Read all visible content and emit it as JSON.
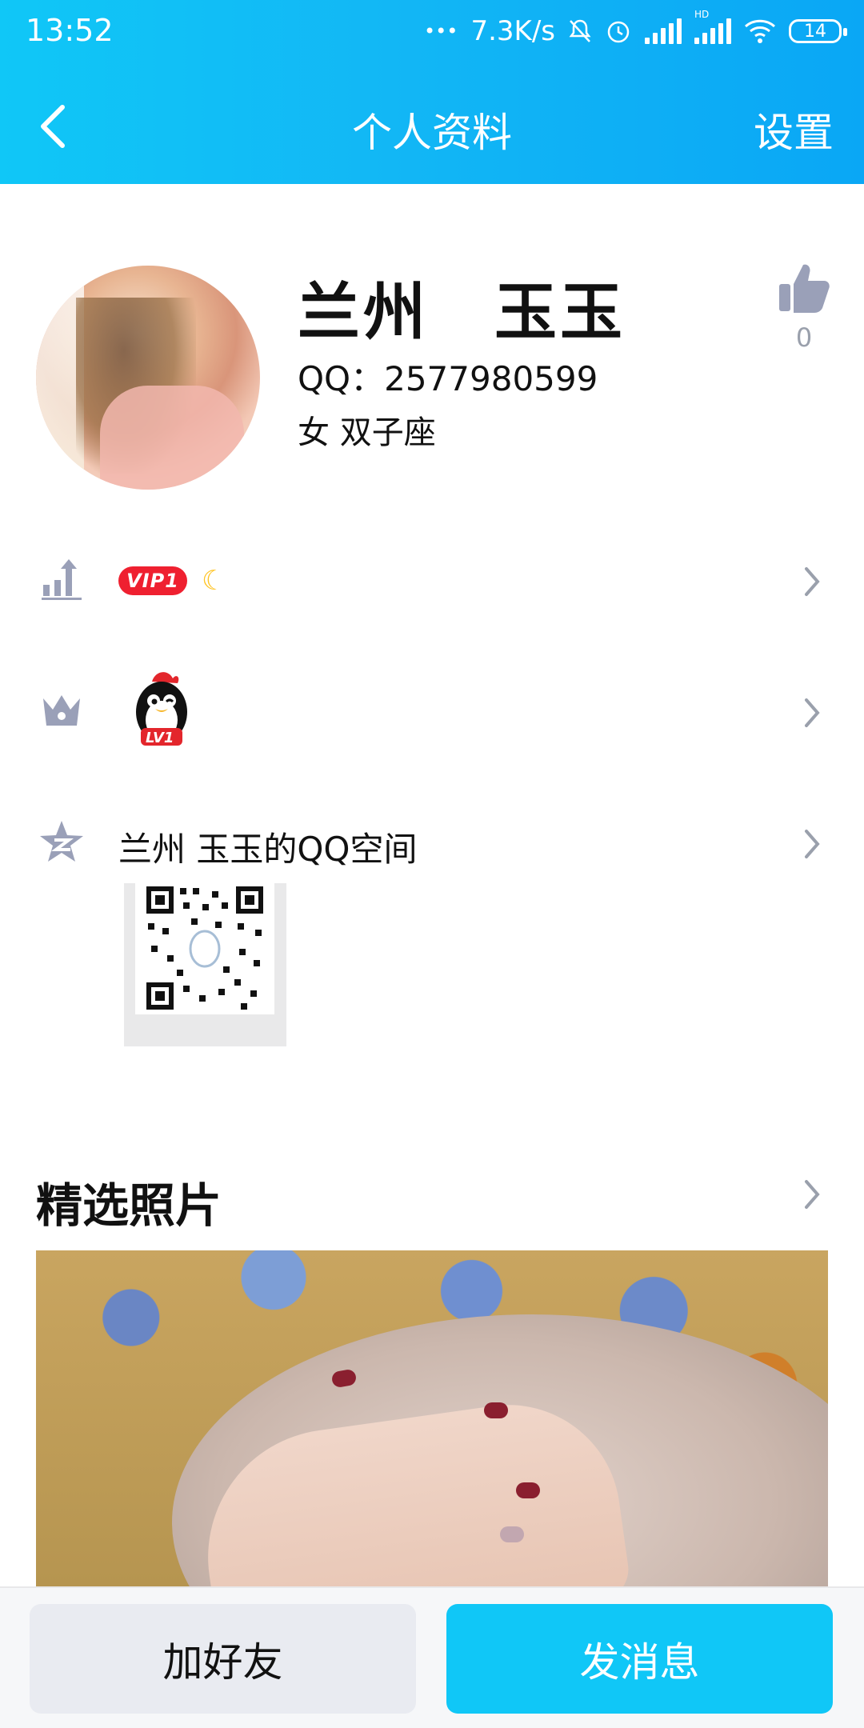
{
  "status": {
    "time": "13:52",
    "net_speed": "7.3K/s",
    "battery": "14",
    "dots": "•••",
    "hd_label": "HD"
  },
  "nav": {
    "title": "个人资料",
    "right_label": "设置"
  },
  "profile": {
    "name": "兰州　玉玉",
    "qq": "QQ：2577980599",
    "meta": "女  双子座",
    "like_count": "0"
  },
  "rows": {
    "vip_label": "VIP1",
    "level_label": "LV1",
    "qzone_label": "兰州  玉玉的QQ空间"
  },
  "section": {
    "photos_title": "精选照片"
  },
  "actions": {
    "add_friend": "加好友",
    "send_message": "发消息"
  },
  "colors": {
    "accent": "#10c7f7",
    "icon_gray": "#9aa0b8",
    "vip_red": "#ef2030"
  },
  "icons": {
    "back": "chevron-left-icon",
    "like": "thumbs-up-icon",
    "level": "bar-chart-up-icon",
    "crown": "crown-icon",
    "star": "star-icon",
    "chevron": "chevron-right-icon",
    "moon": "moon-icon",
    "penguin": "qq-penguin-icon",
    "qr": "qr-code-icon"
  }
}
